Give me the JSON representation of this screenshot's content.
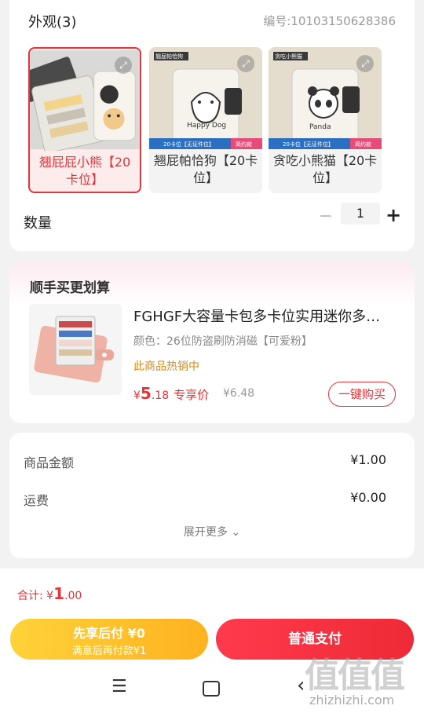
{
  "appearance": {
    "title": "外观(3)",
    "code": "编号:10103150628386",
    "options": [
      {
        "label": "翘屁屁小熊【20卡位】",
        "selected": true
      },
      {
        "label": "翘屁帕恰狗【20卡位】",
        "selected": false
      },
      {
        "label": "贪吃小熊猫【20卡位】",
        "selected": false
      }
    ],
    "thumb_text": {
      "opt2_tag": "翘屁帕恰狗",
      "opt2_band": "20卡位【无证件位】",
      "opt2_band_r": "简约款",
      "opt2_text": "Happy Dog",
      "opt3_tag": "贪吃小熊猫",
      "opt3_band": "20卡位【无证件位】",
      "opt3_band_r": "简约款",
      "opt3_text": "Panda"
    }
  },
  "quantity": {
    "label": "数量",
    "minus": "−",
    "value": "1",
    "plus": "+"
  },
  "upsell": {
    "title": "顺手买更划算",
    "name": "FGHGF大容量卡包多卡位实用迷你多…",
    "spec": "颜色：26位防盗刷防消磁【可爱粉】",
    "hot": "此商品热销中",
    "price_symbol": "¥",
    "price_int": "5",
    "price_dec": ".18",
    "price_tag": "专享价",
    "orig_price": "¥6.48",
    "buy": "一键购买"
  },
  "summary": {
    "rows": [
      {
        "label": "商品金额",
        "value": "¥1.00"
      },
      {
        "label": "运费",
        "value": "¥0.00"
      }
    ],
    "expand": "展开更多"
  },
  "bottom": {
    "total_label": "合计: ",
    "total_symbol": "¥",
    "total_int": "1",
    "total_dec": ".00",
    "later_line1": "先享后付 ¥0",
    "later_line2": "满意后再付款¥1",
    "pay": "普通支付"
  },
  "watermark": {
    "big": "值值值",
    "small": "zhizhizhi.com"
  },
  "colors": {
    "accent": "#e8333a",
    "yellow": "#ffc52a",
    "hot": "#d98a1c"
  }
}
